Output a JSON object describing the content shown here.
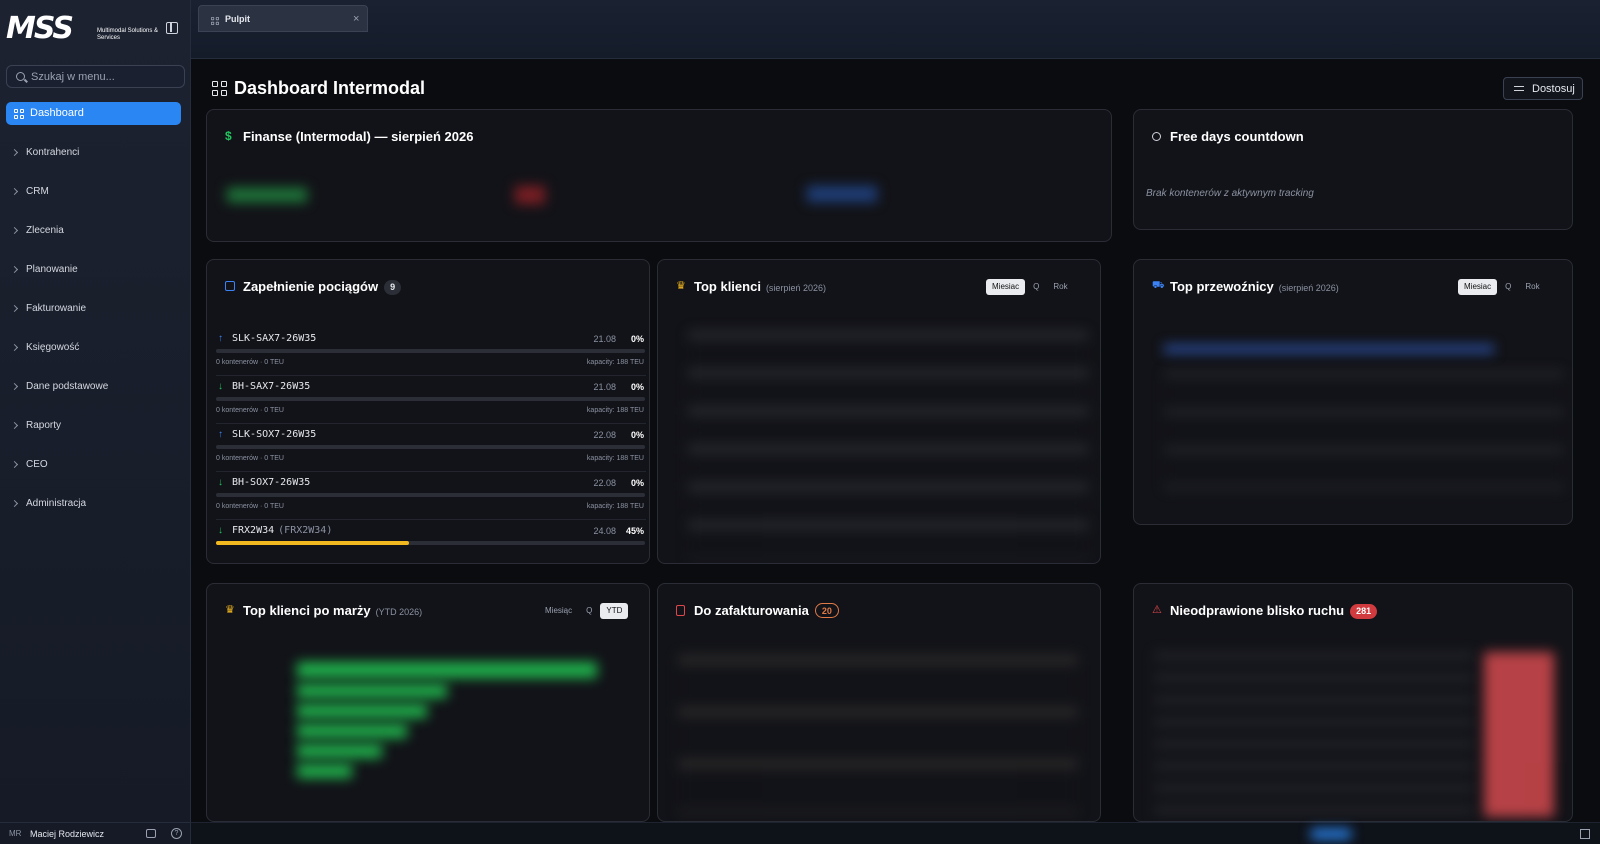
{
  "brand": {
    "logo": "MSS",
    "tagline": "Multimodal Solutions & Services"
  },
  "sidebar": {
    "search_placeholder": "Szukaj w menu...",
    "active_item": "Dashboard",
    "items": [
      "Kontrahenci",
      "CRM",
      "Zlecenia",
      "Planowanie",
      "Fakturowanie",
      "Księgowość",
      "Dane podstawowe",
      "Raporty",
      "CEO",
      "Administracja"
    ],
    "user": {
      "initials": "MR",
      "name": "Maciej Rodziewicz"
    }
  },
  "tabs": [
    {
      "label": "Pulpit",
      "close": "×"
    }
  ],
  "page": {
    "title": "Dashboard Intermodal",
    "customize_label": "Dostosuj"
  },
  "cards": {
    "finance": {
      "title": "Finanse (Intermodal) — sierpień 2026"
    },
    "free_days": {
      "title": "Free days countdown",
      "empty": "Brak kontenerów z aktywnym tracking"
    },
    "trains": {
      "title": "Zapełnienie pociągów",
      "count": "9",
      "rows": [
        {
          "dir": "↑",
          "code": "SLK-SAX7-26W35",
          "alt": "",
          "date": "21.08",
          "pct": "0%",
          "fill": 0,
          "left": "0 kontenerów · 0 TEU",
          "right": "kapacity: 188 TEU"
        },
        {
          "dir": "↓",
          "code": "BH-SAX7-26W35",
          "alt": "",
          "date": "21.08",
          "pct": "0%",
          "fill": 0,
          "left": "0 kontenerów · 0 TEU",
          "right": "kapacity: 188 TEU"
        },
        {
          "dir": "↑",
          "code": "SLK-SOX7-26W35",
          "alt": "",
          "date": "22.08",
          "pct": "0%",
          "fill": 0,
          "left": "0 kontenerów · 0 TEU",
          "right": "kapacity: 188 TEU"
        },
        {
          "dir": "↓",
          "code": "BH-SOX7-26W35",
          "alt": "",
          "date": "22.08",
          "pct": "0%",
          "fill": 0,
          "left": "0 kontenerów · 0 TEU",
          "right": "kapacity: 188 TEU"
        },
        {
          "dir": "↓",
          "code": "FRX2W34",
          "alt": "(FRX2W34)",
          "date": "24.08",
          "pct": "45%",
          "fill": 45,
          "left": "",
          "right": ""
        }
      ]
    },
    "top_clients": {
      "title": "Top klienci",
      "sub": "(sierpień 2026)",
      "seg": [
        "Miesiac",
        "Q",
        "Rok"
      ],
      "active": 0
    },
    "top_carriers": {
      "title": "Top przewoźnicy",
      "sub": "(sierpień 2026)",
      "seg": [
        "Miesiac",
        "Q",
        "Rok"
      ],
      "active": 0
    },
    "top_margin": {
      "title": "Top klienci po marży",
      "sub": "(YTD 2026)",
      "seg": [
        "Miesiąc",
        "Q",
        "YTD"
      ],
      "active": 2
    },
    "to_invoice": {
      "title": "Do zafakturowania",
      "count": "20"
    },
    "unresolved": {
      "title": "Nieodprawione blisko ruchu",
      "count": "281"
    }
  },
  "colors": {
    "accent": "#2a86f2",
    "warning": "#f2b81f",
    "danger": "#e0474c",
    "success": "#22c55e"
  }
}
